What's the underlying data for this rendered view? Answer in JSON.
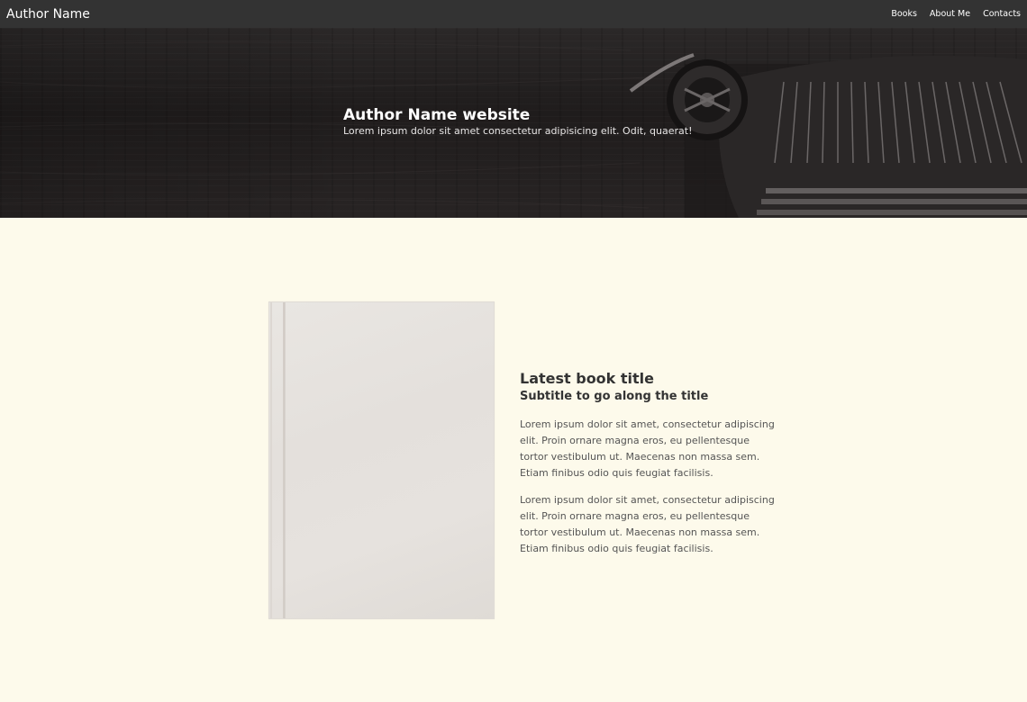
{
  "navbar": {
    "brand": "Author Name",
    "links": [
      "Books",
      "About Me",
      "Contacts"
    ]
  },
  "hero": {
    "title": "Author Name website",
    "subtitle": "Lorem ipsum dolor sit amet consectetur adipisicing elit. Odit, quaerat!"
  },
  "book": {
    "title": "Latest book title",
    "subtitle": "Subtitle to go along the title",
    "paragraphs": [
      "Lorem ipsum dolor sit amet, consectetur adipiscing elit. Proin ornare magna eros, eu pellentesque tortor vestibulum ut. Maecenas non massa sem. Etiam finibus odio quis feugiat facilisis.",
      "Lorem ipsum dolor sit amet, consectetur adipiscing elit. Proin ornare magna eros, eu pellentesque tortor vestibulum ut. Maecenas non massa sem. Etiam finibus odio quis feugiat facilisis."
    ]
  },
  "colors": {
    "navbar_bg": "#333333",
    "page_bg": "#fdfaeb",
    "text_dark": "#333333"
  }
}
